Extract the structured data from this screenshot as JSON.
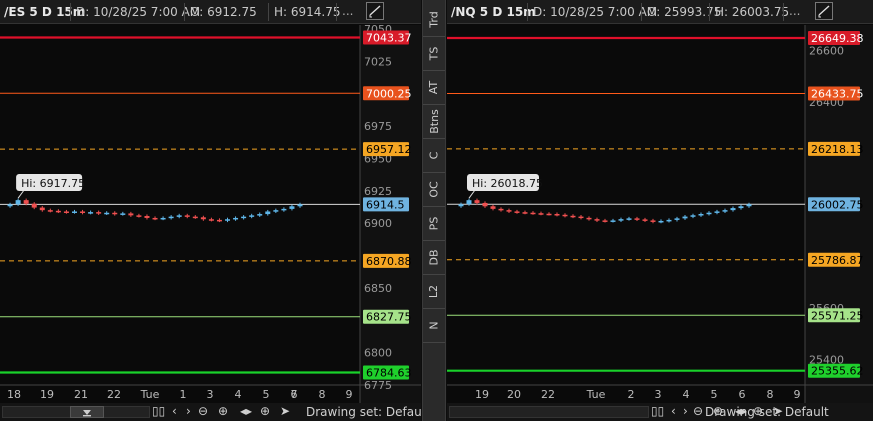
{
  "left": {
    "header": {
      "symbol": "/ES 5 D 15m",
      "date": "D: 10/28/25 7:00 AM",
      "open": "O: 6912.75",
      "high": "H: 6914.75",
      "more": "..."
    },
    "footer": {
      "drawing_set": "Drawing set: Default"
    },
    "chart_data": {
      "type": "line",
      "yticks": [
        7050,
        7025,
        7000,
        6975,
        6950,
        6925,
        6900,
        6875,
        6850,
        6825,
        6800,
        6775
      ],
      "ytick_labels": [
        "7050",
        "7025",
        "",
        "6975",
        "6950",
        "6925",
        "6900",
        "",
        "6850",
        "",
        "6800",
        "6775"
      ],
      "ylim": [
        6775,
        7053
      ],
      "xticks": [
        "18",
        "19",
        "21",
        "22",
        "Tue",
        "1",
        "3",
        "4",
        "5",
        "6",
        "7",
        "8",
        "9"
      ],
      "levels": [
        {
          "value": 7043.37,
          "label": "7043.37",
          "color": "#e0102a",
          "style": "solid",
          "tag_bg": "#d81b29",
          "tag_fg": "#ffffff"
        },
        {
          "value": 7000.25,
          "label": "7000.25",
          "color": "#ff5a1a",
          "style": "solid",
          "tag_bg": "#e8521d",
          "tag_fg": "#ffffff"
        },
        {
          "value": 6957.12,
          "label": "6957.12",
          "color": "#f5a623",
          "style": "dashed",
          "tag_bg": "#f5a623",
          "tag_fg": "#000000"
        },
        {
          "value": 6914.5,
          "label": "6914.5",
          "color": "#ffffff",
          "style": "solid",
          "tag_bg": "#6fb3e0",
          "tag_fg": "#000000"
        },
        {
          "value": 6870.88,
          "label": "6870.88",
          "color": "#f5a623",
          "style": "dashed",
          "tag_bg": "#f5a623",
          "tag_fg": "#000000"
        },
        {
          "value": 6827.75,
          "label": "6827.75",
          "color": "#9be07a",
          "style": "solid",
          "tag_bg": "#a6e38a",
          "tag_fg": "#000000"
        },
        {
          "value": 6784.63,
          "label": "6784.63",
          "color": "#19d12a",
          "style": "solid",
          "tag_bg": "#1fd02c",
          "tag_fg": "#000000"
        }
      ],
      "high_annotation": {
        "text": "Hi: 6917.75",
        "value": 6917.75
      },
      "series": [
        {
          "values": [
            6913,
            6914.5,
            6917.75,
            6915,
            6912,
            6910,
            6909.5,
            6909,
            6908.5,
            6909,
            6908,
            6908.5,
            6907.5,
            6908,
            6907,
            6907.5,
            6906,
            6905.5,
            6904,
            6903.5,
            6904,
            6905,
            6906,
            6905,
            6904.5,
            6903,
            6902.5,
            6902,
            6903,
            6904,
            6905,
            6906,
            6907,
            6909,
            6910,
            6911,
            6913,
            6914.5
          ]
        }
      ]
    }
  },
  "right": {
    "header": {
      "symbol": "/NQ 5 D 15m",
      "date": "D: 10/28/25 7:00 AM",
      "open": "O: 25993.75",
      "high": "H: 26003.75",
      "more": "..."
    },
    "footer": {
      "drawing_set": "Drawing set: Default"
    },
    "chart_data": {
      "type": "line",
      "yticks": [
        26600,
        26400,
        26200,
        26000,
        25800,
        25600,
        25400
      ],
      "ytick_labels": [
        "26600",
        "26400",
        "",
        "",
        "",
        "25600",
        "25400"
      ],
      "ylim": [
        25300,
        26700
      ],
      "xticks": [
        "19",
        "20",
        "22",
        "Tue",
        "2",
        "3",
        "4",
        "5",
        "6",
        "8",
        "9"
      ],
      "levels": [
        {
          "value": 26649.38,
          "label": "26649.38",
          "color": "#e0102a",
          "style": "solid",
          "tag_bg": "#d81b29",
          "tag_fg": "#ffffff"
        },
        {
          "value": 26433.75,
          "label": "26433.75",
          "color": "#ff5a1a",
          "style": "solid",
          "tag_bg": "#e8521d",
          "tag_fg": "#ffffff"
        },
        {
          "value": 26218.13,
          "label": "26218.13",
          "color": "#f5a623",
          "style": "dashed",
          "tag_bg": "#f5a623",
          "tag_fg": "#000000"
        },
        {
          "value": 26002.75,
          "label": "26002.75",
          "color": "#ffffff",
          "style": "solid",
          "tag_bg": "#6fb3e0",
          "tag_fg": "#000000"
        },
        {
          "value": 25786.87,
          "label": "25786.87",
          "color": "#f5a623",
          "style": "dashed",
          "tag_bg": "#f5a623",
          "tag_fg": "#000000"
        },
        {
          "value": 25571.25,
          "label": "25571.25",
          "color": "#9be07a",
          "style": "solid",
          "tag_bg": "#a6e38a",
          "tag_fg": "#000000"
        },
        {
          "value": 25355.62,
          "label": "25355.62",
          "color": "#19d12a",
          "style": "solid",
          "tag_bg": "#1fd02c",
          "tag_fg": "#000000"
        }
      ],
      "high_annotation": {
        "text": "Hi: 26018.75",
        "value": 26018.75
      },
      "series": [
        {
          "values": [
            25995,
            26003,
            26018.75,
            26008,
            25995,
            25985,
            25980,
            25975,
            25972,
            25970,
            25968,
            25966,
            25965,
            25962,
            25958,
            25955,
            25950,
            25945,
            25940,
            25938,
            25940,
            25945,
            25948,
            25944,
            25940,
            25935,
            25938,
            25942,
            25948,
            25955,
            25960,
            25965,
            25970,
            25975,
            25980,
            25988,
            25995,
            26002.75
          ]
        }
      ]
    }
  },
  "side_tabs": [
    "Trd",
    "TS",
    "AT",
    "Btns",
    "C",
    "OC",
    "PS",
    "DB",
    "L2",
    "N"
  ],
  "colors": {
    "up": "#5fb7ea",
    "down": "#f05050",
    "background": "#0a0a0a"
  }
}
